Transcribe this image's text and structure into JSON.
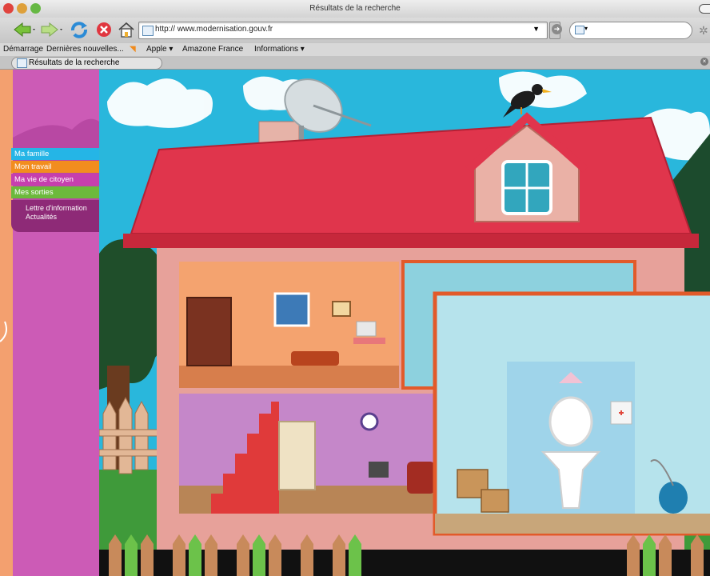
{
  "window": {
    "title": "Résultats de la recherche"
  },
  "toolbar": {
    "url": "http:// www.modernisation.gouv.fr"
  },
  "bookmarks": [
    "Démarrage",
    "Dernières nouvelles...",
    "Apple",
    "Amazone France",
    "Informations"
  ],
  "tab": {
    "label": "Résultats de la recherche"
  },
  "nav": [
    {
      "label": "Ma famille",
      "color": "#25b5e6"
    },
    {
      "label": "Mon travail",
      "color": "#f28d1f"
    },
    {
      "label": "Ma vie de citoyen",
      "color": "#c63fae"
    },
    {
      "label": "Mes sorties",
      "color": "#6cb93c"
    }
  ],
  "nav_extra": [
    "Lettre d'information",
    "Actualités"
  ],
  "colors": {
    "sky": "#29b7dc",
    "roof": "#e0354c",
    "sidebar": "#cc5bb6",
    "bathroom": "#b6e3ec",
    "frame": "#e25a2a"
  }
}
